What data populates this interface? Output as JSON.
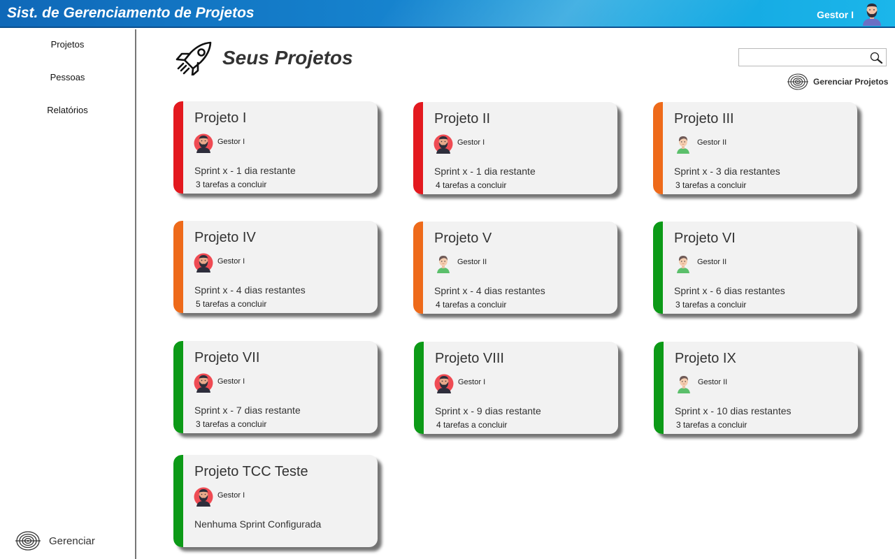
{
  "header": {
    "title": "Sist. de Gerenciamento de Projetos",
    "user_name": "Gestor I",
    "avatar_icon": "user-bearded-avatar-icon"
  },
  "sidebar": {
    "items": [
      {
        "label": "Projetos"
      },
      {
        "label": "Pessoas"
      },
      {
        "label": "Relatórios"
      }
    ],
    "manage_label": "Gerenciar",
    "manage_icon": "target-icon"
  },
  "main": {
    "heading": "Seus Projetos",
    "heading_icon": "rocket-icon",
    "search": {
      "value": "",
      "placeholder": ""
    },
    "manage_projects_label": "Gerenciar Projetos"
  },
  "colors": {
    "red": "#e3191f",
    "orange": "#ee6a1a",
    "green": "#0c9a17"
  },
  "projects": [
    {
      "title": "Projeto I",
      "manager": "Gestor I",
      "avatar": "bearded",
      "status": "red",
      "sprint": "Sprint x - 1 dia restante",
      "tasks": "3 tarefas a concluir"
    },
    {
      "title": "Projeto II",
      "manager": "Gestor I",
      "avatar": "bearded",
      "status": "red",
      "sprint": "Sprint x - 1 dia restante",
      "tasks": "4 tarefas a concluir"
    },
    {
      "title": "Projeto III",
      "manager": "Gestor II",
      "avatar": "young",
      "status": "orange",
      "sprint": "Sprint x - 3 dia restantes",
      "tasks": "3 tarefas a concluir"
    },
    {
      "title": "Projeto IV",
      "manager": "Gestor I",
      "avatar": "bearded",
      "status": "orange",
      "sprint": "Sprint x - 4 dias restantes",
      "tasks": "5 tarefas a concluir"
    },
    {
      "title": "Projeto V",
      "manager": "Gestor II",
      "avatar": "young",
      "status": "orange",
      "sprint": "Sprint x - 4 dias restantes",
      "tasks": "4 tarefas a concluir"
    },
    {
      "title": "Projeto VI",
      "manager": "Gestor II",
      "avatar": "young",
      "status": "green",
      "sprint": "Sprint x - 6 dias restantes",
      "tasks": "3 tarefas a concluir"
    },
    {
      "title": "Projeto VII",
      "manager": "Gestor I",
      "avatar": "bearded",
      "status": "green",
      "sprint": "Sprint x - 7 dias restante",
      "tasks": "3 tarefas a concluir"
    },
    {
      "title": "Projeto VIII",
      "manager": "Gestor I",
      "avatar": "bearded",
      "status": "green",
      "sprint": "Sprint x - 9 dias restante",
      "tasks": "4 tarefas a concluir"
    },
    {
      "title": "Projeto IX",
      "manager": "Gestor II",
      "avatar": "young",
      "status": "green",
      "sprint": "Sprint x - 10 dias restantes",
      "tasks": "3 tarefas a concluir"
    },
    {
      "title": "Projeto TCC Teste",
      "manager": "Gestor I",
      "avatar": "bearded",
      "status": "green",
      "sprint": "Nenhuma Sprint Configurada",
      "tasks": ""
    }
  ]
}
